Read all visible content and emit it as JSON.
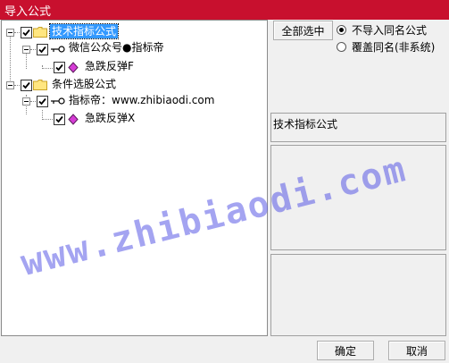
{
  "window": {
    "title": "导入公式"
  },
  "tree": {
    "root1": {
      "label": "技术指标公式"
    },
    "root1_child": {
      "label": "微信公众号●指标帝"
    },
    "root1_leaf": {
      "label": "急跌反弹F"
    },
    "root2": {
      "label": "条件选股公式"
    },
    "root2_child": {
      "label": "指标帝：www.zhibiaodi.com"
    },
    "root2_leaf": {
      "label": "急跌反弹X"
    }
  },
  "options": {
    "select_all_label": "全部选中",
    "radio_no_import": "不导入同名公式",
    "radio_overwrite": "覆盖同名(非系统)",
    "selected": "不导入同名公式"
  },
  "info": {
    "category": "技术指标公式"
  },
  "footer": {
    "ok_label": "确定",
    "cancel_label": "取消"
  },
  "watermark": {
    "text": "www.zhibiaodi.com"
  }
}
